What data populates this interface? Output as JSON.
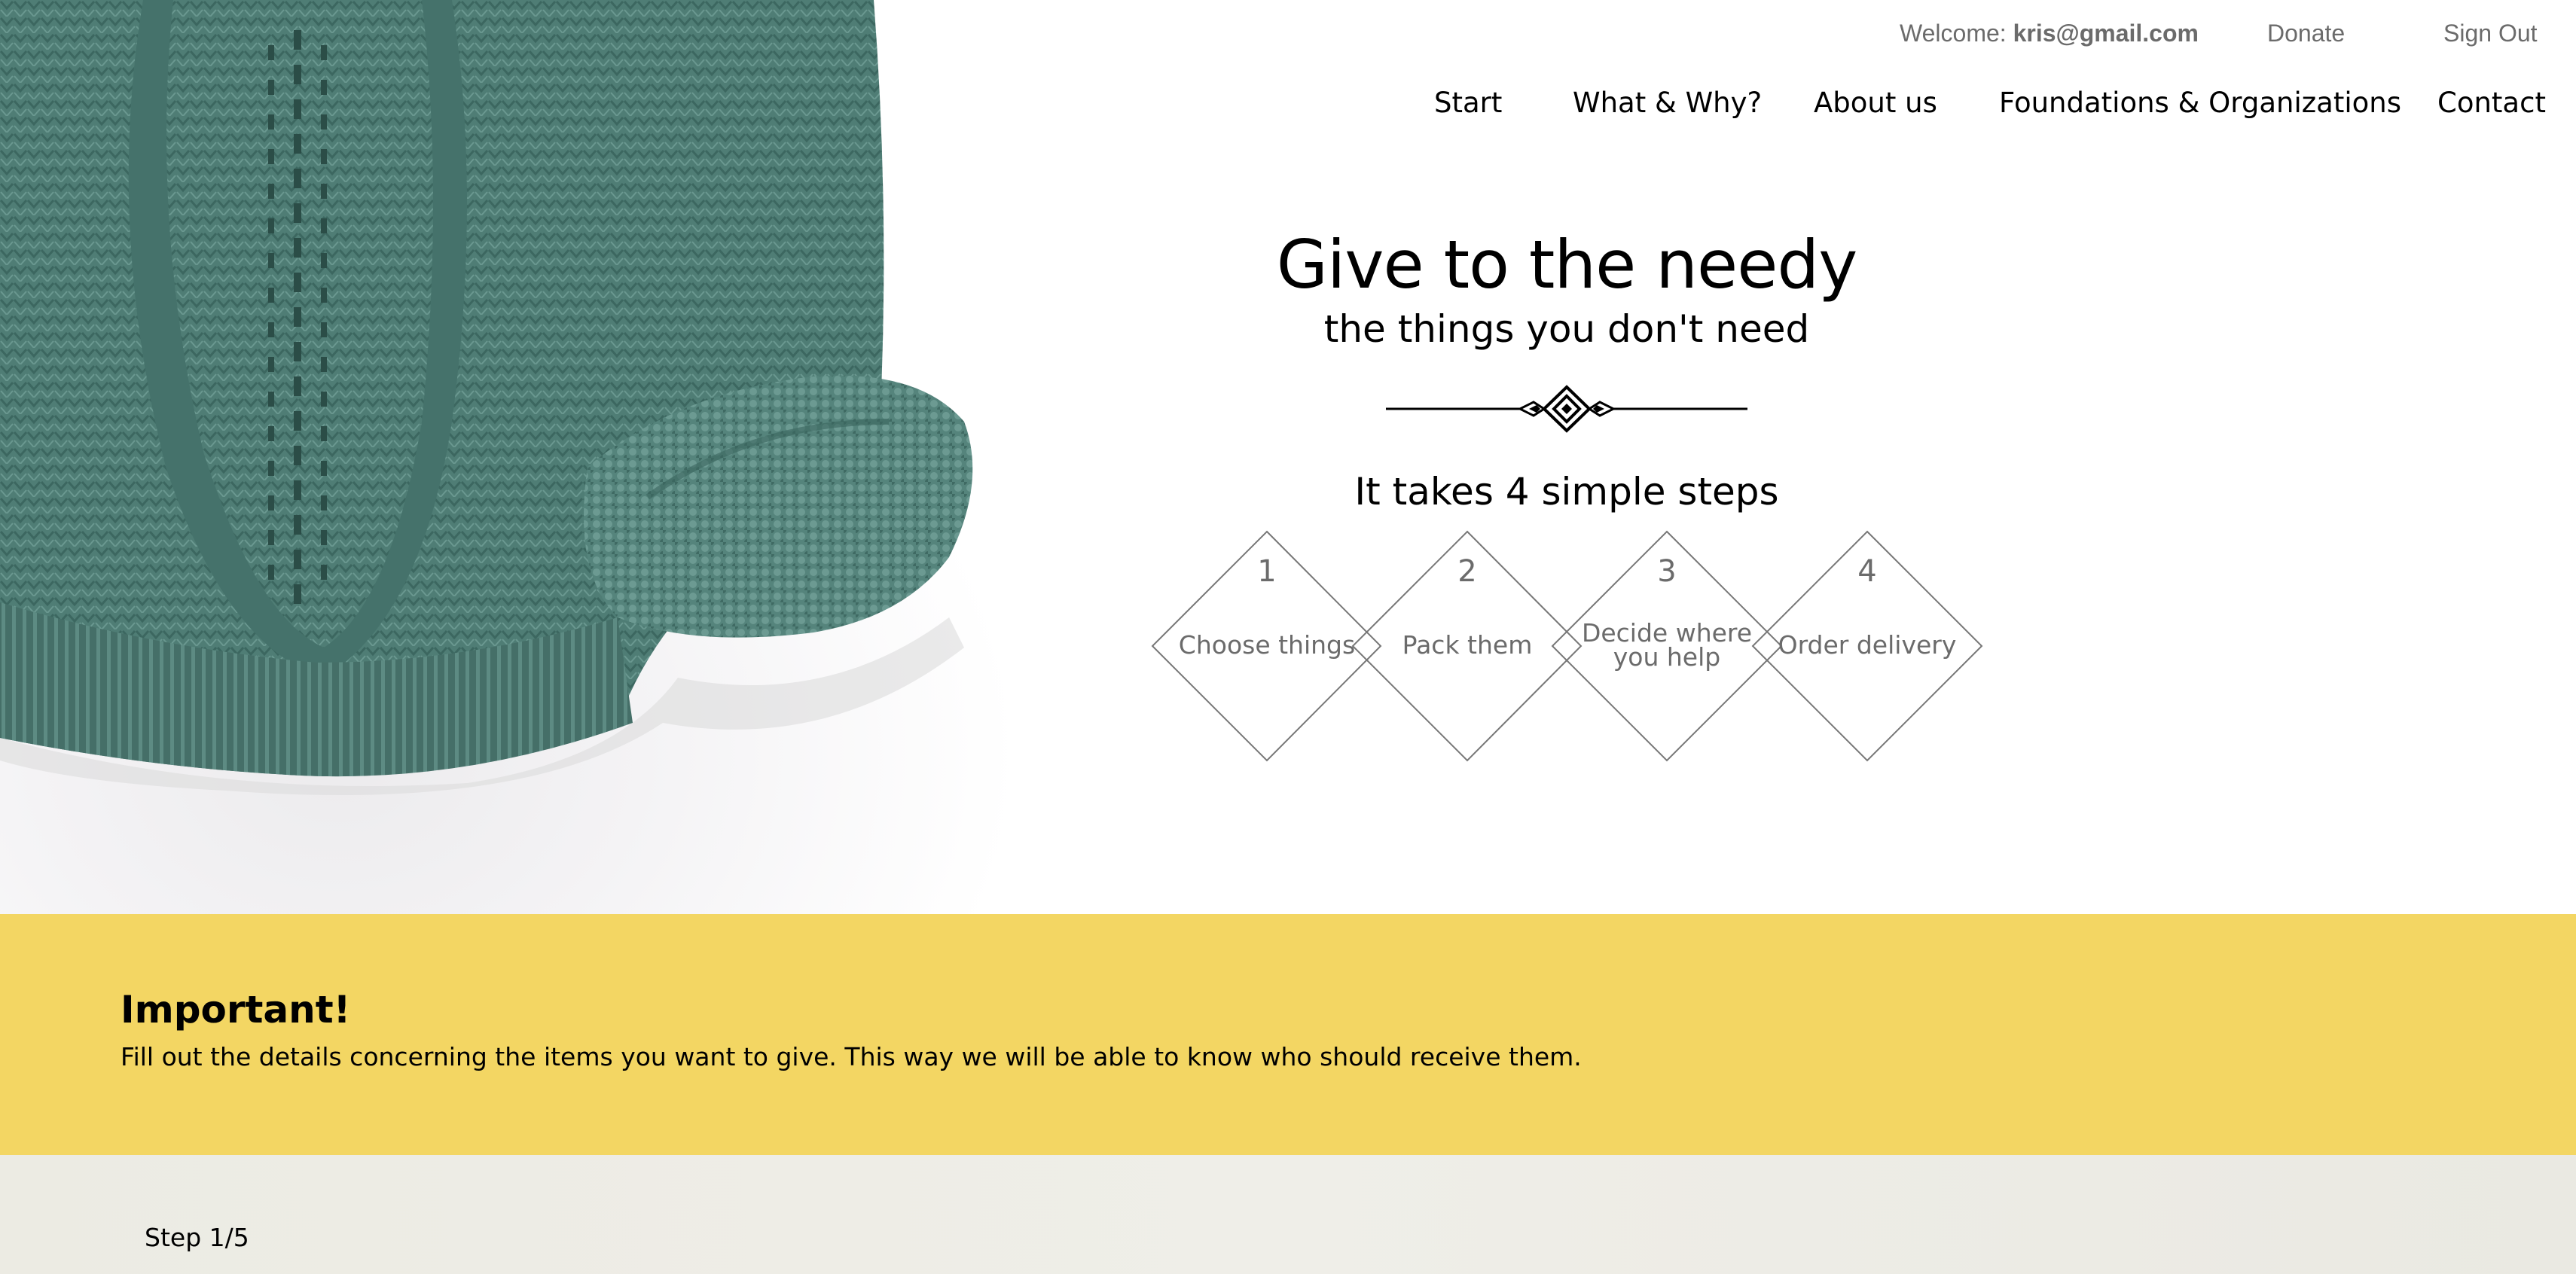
{
  "header": {
    "welcome_prefix": "Welcome:",
    "user_email": "kris@gmail.com",
    "donate_label": "Donate",
    "signout_label": "Sign Out"
  },
  "nav": {
    "items": [
      "Start",
      "What & Why?",
      "About us",
      "Foundations & Organizations",
      "Contact"
    ]
  },
  "hero": {
    "title": "Give to the needy",
    "subtitle": "the things you don't need",
    "steps_title": "It takes 4 simple steps",
    "steps": [
      {
        "number": "1",
        "label_line1": "Choose things",
        "label_line2": ""
      },
      {
        "number": "2",
        "label_line1": "Pack them",
        "label_line2": ""
      },
      {
        "number": "3",
        "label_line1": "Decide where",
        "label_line2": "you help"
      },
      {
        "number": "4",
        "label_line1": "Order delivery",
        "label_line2": ""
      }
    ]
  },
  "important": {
    "title": "Important!",
    "text": "Fill out the details concerning the items you want to give. This way we will be able to know who should receive them."
  },
  "form": {
    "step_counter": "Step 1/5"
  },
  "colors": {
    "band_yellow": "#f3d663",
    "sweater_green": "#4d7a72",
    "muted_text": "#6b6b6b"
  }
}
